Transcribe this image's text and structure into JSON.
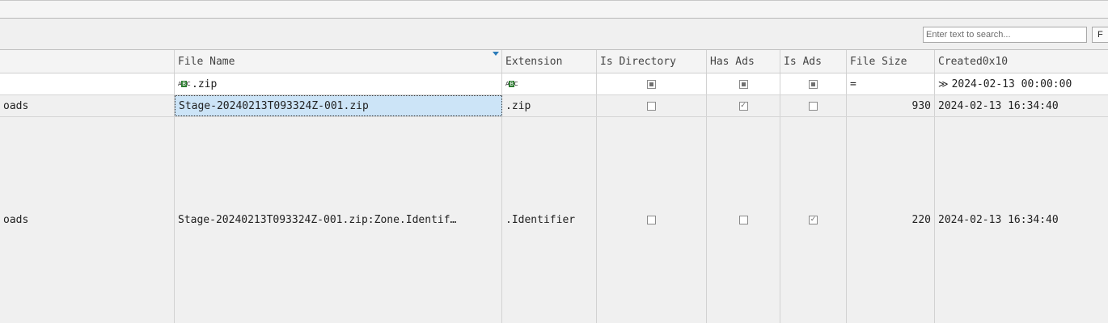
{
  "toolbar": {
    "search_placeholder": "Enter text to search...",
    "button_label": "F"
  },
  "columns": [
    "File Name",
    "Extension",
    "Is Directory",
    "Has Ads",
    "Is Ads",
    "File Size",
    "Created0x10"
  ],
  "filter_row": {
    "file_name": ".zip",
    "extension": "",
    "file_size_op": "=",
    "created_op": "≫",
    "created": "2024-02-13 00:00:00"
  },
  "rows": [
    {
      "parent_path_tail": "oads",
      "file_name": "Stage-20240213T093324Z-001.zip",
      "extension": ".zip",
      "is_directory": false,
      "has_ads": true,
      "is_ads": false,
      "file_size": "930",
      "created": "2024-02-13 16:34:40"
    },
    {
      "parent_path_tail": "oads",
      "file_name": "Stage-20240213T093324Z-001.zip:Zone.Identif…",
      "extension": ".Identifier",
      "is_directory": false,
      "has_ads": false,
      "is_ads": true,
      "file_size": "220",
      "created": "2024-02-13 16:34:40"
    }
  ]
}
